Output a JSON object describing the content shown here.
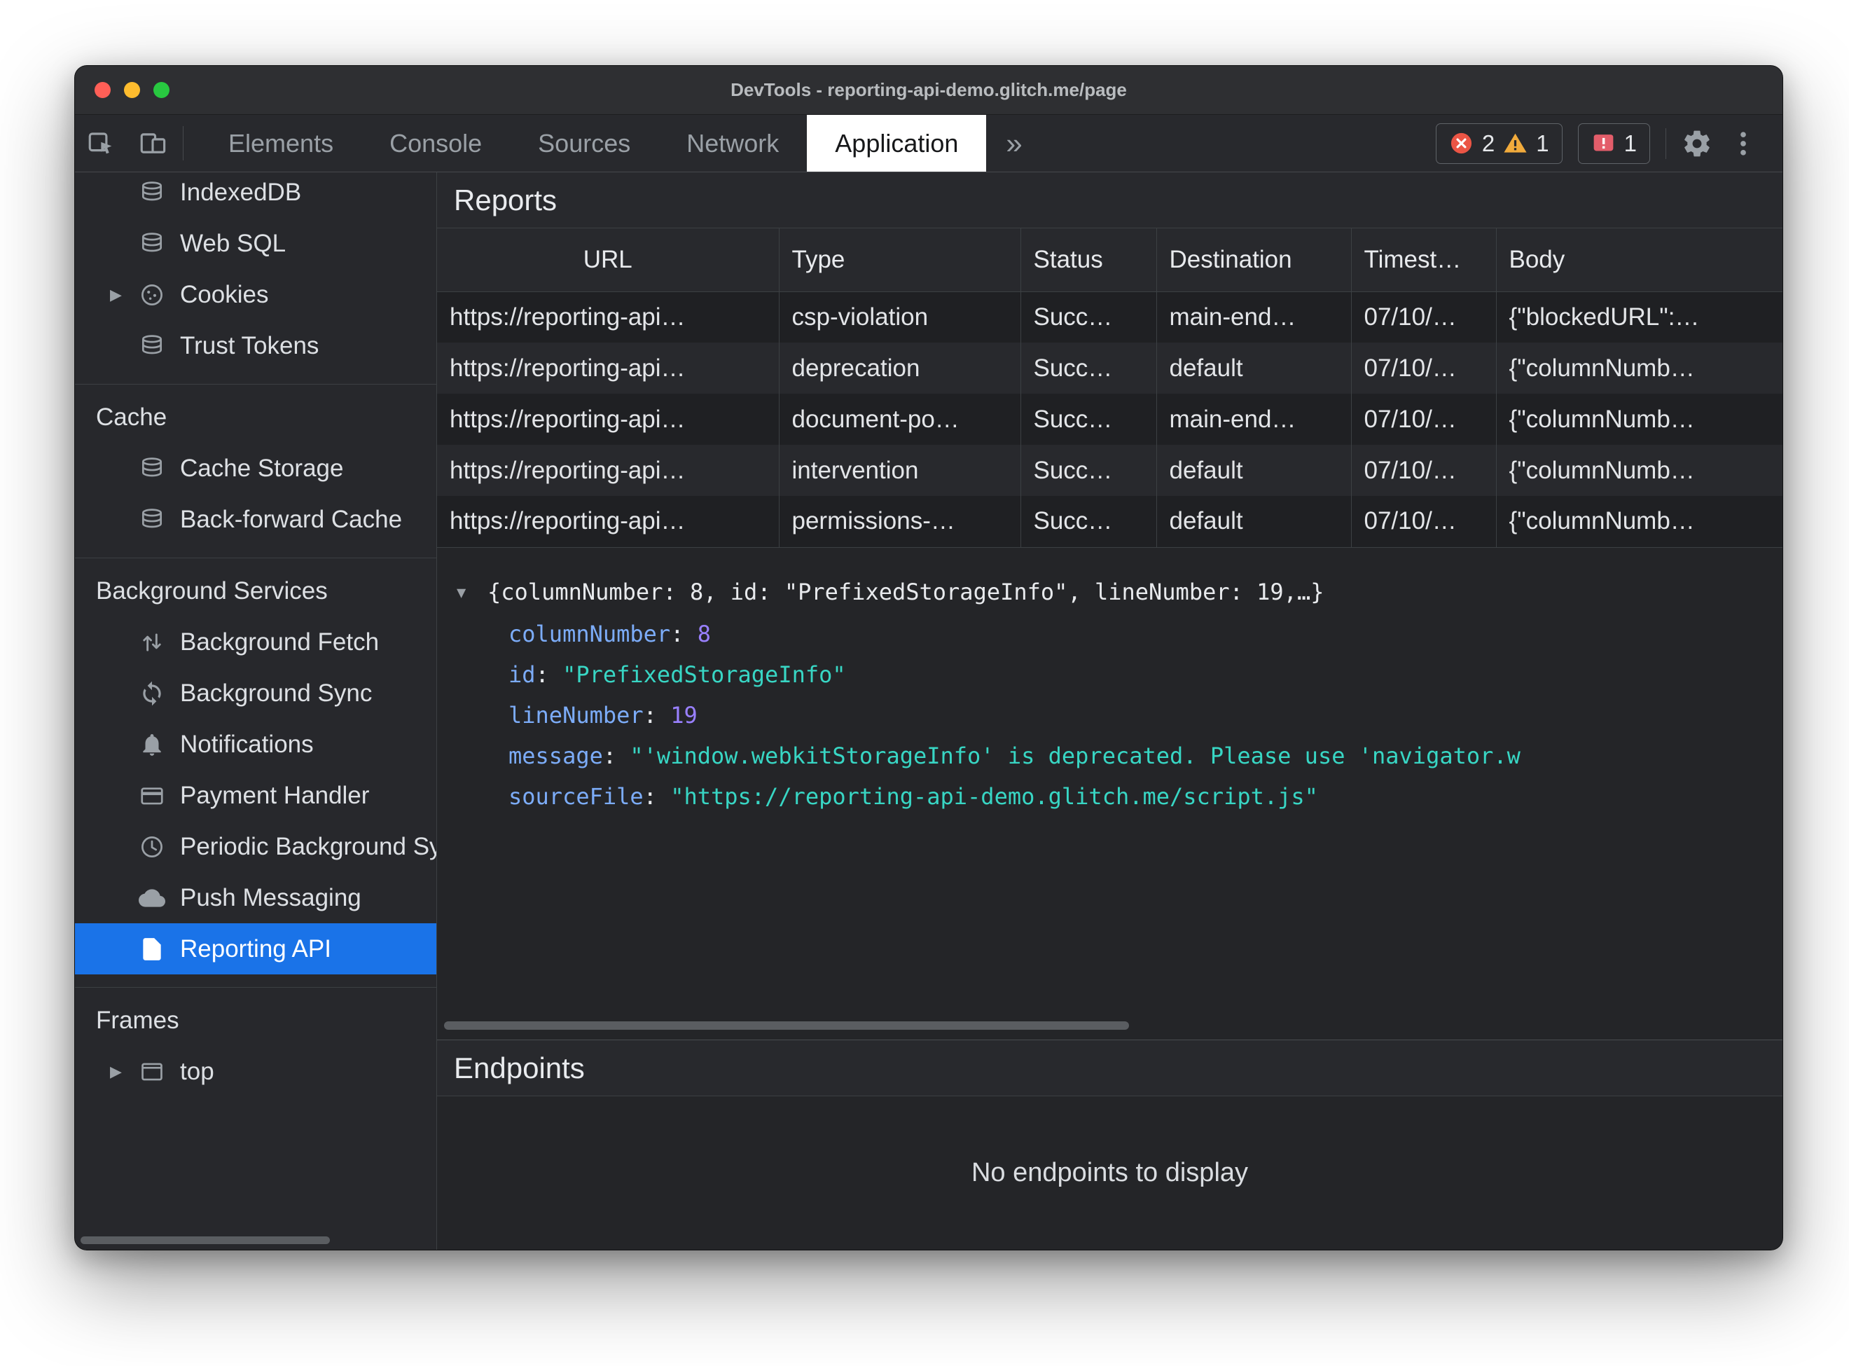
{
  "window": {
    "title": "DevTools - reporting-api-demo.glitch.me/page"
  },
  "icons": {
    "expanded": "▼",
    "collapsed": "▶"
  },
  "punctuation": {
    "colon_separator": ": "
  },
  "toolbar": {
    "tabs": [
      {
        "label": "Elements"
      },
      {
        "label": "Console"
      },
      {
        "label": "Sources"
      },
      {
        "label": "Network"
      },
      {
        "label": "Application"
      }
    ],
    "more_tabs_label": "»",
    "error_count": "2",
    "warning_count": "1",
    "issues_count": "1"
  },
  "sidebar": {
    "top_items": [
      {
        "label": "IndexedDB",
        "icon": "database-icon"
      },
      {
        "label": "Web SQL",
        "icon": "database-icon"
      },
      {
        "label": "Cookies",
        "icon": "cookie-icon"
      },
      {
        "label": "Trust Tokens",
        "icon": "database-icon"
      }
    ],
    "cache": {
      "title": "Cache",
      "items": [
        {
          "label": "Cache Storage",
          "icon": "database-icon"
        },
        {
          "label": "Back-forward Cache",
          "icon": "database-icon"
        }
      ]
    },
    "background": {
      "title": "Background Services",
      "items": [
        {
          "label": "Background Fetch",
          "icon": "background-fetch-icon"
        },
        {
          "label": "Background Sync",
          "icon": "background-sync-icon"
        },
        {
          "label": "Notifications",
          "icon": "bell-icon"
        },
        {
          "label": "Payment Handler",
          "icon": "payment-card-icon"
        },
        {
          "label": "Periodic Background Sync",
          "icon": "clock-icon"
        },
        {
          "label": "Push Messaging",
          "icon": "cloud-icon"
        },
        {
          "label": "Reporting API",
          "icon": "document-icon"
        }
      ]
    },
    "frames": {
      "title": "Frames",
      "items": [
        {
          "label": "top",
          "icon": "frame-icon"
        }
      ]
    }
  },
  "reports": {
    "title": "Reports",
    "columns": [
      "URL",
      "Type",
      "Status",
      "Destination",
      "Timest…",
      "Body"
    ],
    "rows": [
      {
        "url": "https://reporting-api…",
        "type": "csp-violation",
        "status": "Succ…",
        "destination": "main-end…",
        "timestamp": "07/10/…",
        "body": "{\"blockedURL\":…"
      },
      {
        "url": "https://reporting-api…",
        "type": "deprecation",
        "status": "Succ…",
        "destination": "default",
        "timestamp": "07/10/…",
        "body": "{\"columnNumb…"
      },
      {
        "url": "https://reporting-api…",
        "type": "document-po…",
        "status": "Succ…",
        "destination": "main-end…",
        "timestamp": "07/10/…",
        "body": "{\"columnNumb…"
      },
      {
        "url": "https://reporting-api…",
        "type": "intervention",
        "status": "Succ…",
        "destination": "default",
        "timestamp": "07/10/…",
        "body": "{\"columnNumb…"
      },
      {
        "url": "https://reporting-api…",
        "type": "permissions-…",
        "status": "Succ…",
        "destination": "default",
        "timestamp": "07/10/…",
        "body": "{\"columnNumb…"
      }
    ]
  },
  "report_detail": {
    "summary": "{columnNumber: 8, id: \"PrefixedStorageInfo\", lineNumber: 19,…}",
    "properties": [
      {
        "key": "columnNumber",
        "value": "8",
        "kind": "number"
      },
      {
        "key": "id",
        "value": "\"PrefixedStorageInfo\"",
        "kind": "string"
      },
      {
        "key": "lineNumber",
        "value": "19",
        "kind": "number"
      },
      {
        "key": "message",
        "value": "\"'window.webkitStorageInfo' is deprecated. Please use 'navigator.w",
        "kind": "string"
      },
      {
        "key": "sourceFile",
        "value": "\"https://reporting-api-demo.glitch.me/script.js\"",
        "kind": "string"
      }
    ]
  },
  "endpoints": {
    "title": "Endpoints",
    "empty_message": "No endpoints to display"
  },
  "colors": {
    "selection_blue": "#1a73e8",
    "key_blue": "#7cacf8",
    "number_purple": "#9980ff",
    "string_teal": "#38d6c4",
    "error_red": "#eb5545",
    "warning_yellow": "#f2ab3c",
    "issues_red": "#e35d6a"
  }
}
